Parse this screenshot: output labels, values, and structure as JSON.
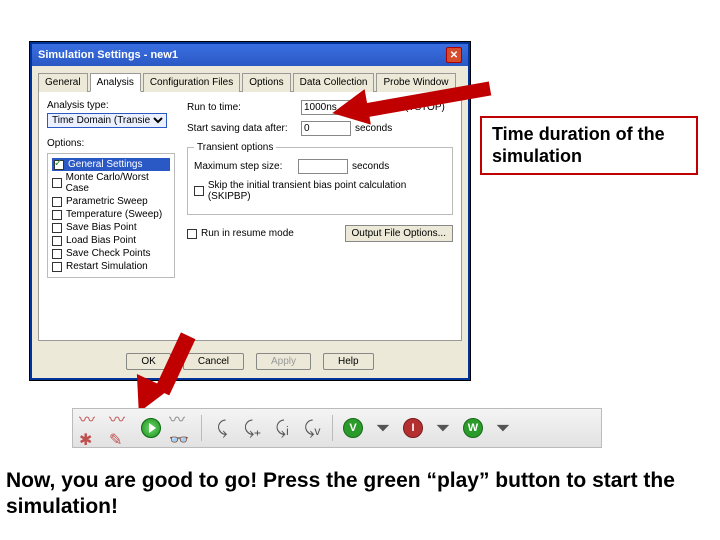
{
  "dialog": {
    "title": "Simulation Settings - new1",
    "tabs": [
      "General",
      "Analysis",
      "Configuration Files",
      "Options",
      "Data Collection",
      "Probe Window"
    ],
    "active_tab": "Analysis",
    "analysis_type_label": "Analysis type:",
    "analysis_type_value": "Time Domain (Transient)",
    "options_label": "Options:",
    "option_items": [
      {
        "label": "General Settings",
        "checked": true,
        "selected": true
      },
      {
        "label": "Monte Carlo/Worst Case",
        "checked": false
      },
      {
        "label": "Parametric Sweep",
        "checked": false
      },
      {
        "label": "Temperature (Sweep)",
        "checked": false
      },
      {
        "label": "Save Bias Point",
        "checked": false
      },
      {
        "label": "Load Bias Point",
        "checked": false
      },
      {
        "label": "Save Check Points",
        "checked": false
      },
      {
        "label": "Restart Simulation",
        "checked": false
      }
    ],
    "run_to_time_label": "Run to time:",
    "run_to_time_value": "1000ns",
    "run_to_time_unit": "seconds (TSTOP)",
    "start_saving_label": "Start saving data after:",
    "start_saving_value": "0",
    "start_saving_unit": "seconds",
    "transient_group": "Transient options",
    "max_step_label": "Maximum step size:",
    "max_step_value": "",
    "max_step_unit": "seconds",
    "skip_label": "Skip the initial transient bias point calculation (SKIPBP)",
    "resume_label": "Run in resume mode",
    "output_btn": "Output File Options...",
    "ok": "OK",
    "cancel": "Cancel",
    "apply": "Apply",
    "help": "Help"
  },
  "callout": "Time duration of the simulation",
  "caption": "Now, you are good to go! Press the green “play” button to start the simulation!",
  "toolbar": {
    "v": "V",
    "i": "I",
    "w": "W"
  }
}
